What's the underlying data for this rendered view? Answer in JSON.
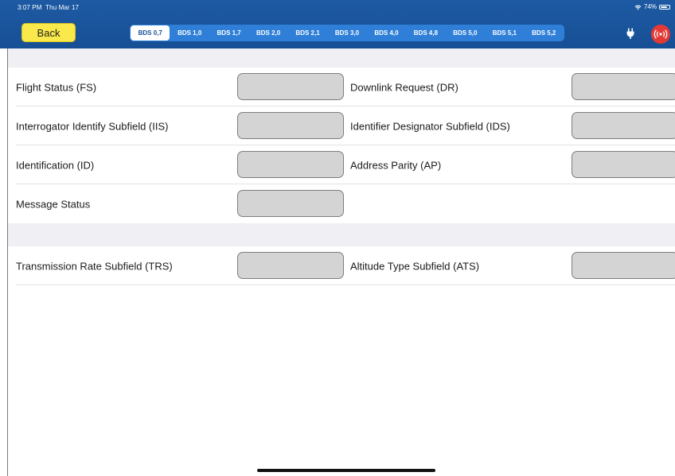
{
  "status_bar": {
    "time": "3:07 PM",
    "date": "Thu Mar 17",
    "battery": "74%"
  },
  "toolbar": {
    "back_label": "Back",
    "tabs": [
      {
        "label": "BDS 0,7",
        "selected": true
      },
      {
        "label": "BDS 1,0",
        "selected": false
      },
      {
        "label": "BDS 1,7",
        "selected": false
      },
      {
        "label": "BDS 2,0",
        "selected": false
      },
      {
        "label": "BDS 2,1",
        "selected": false
      },
      {
        "label": "BDS 3,0",
        "selected": false
      },
      {
        "label": "BDS 4,0",
        "selected": false
      },
      {
        "label": "BDS 4,8",
        "selected": false
      },
      {
        "label": "BDS 5,0",
        "selected": false
      },
      {
        "label": "BDS 5,1",
        "selected": false
      },
      {
        "label": "BDS 5,2",
        "selected": false
      }
    ],
    "icons": [
      "plug-icon",
      "broadcast-icon"
    ]
  },
  "colors": {
    "toolbar_bg": "#1d5aa3",
    "tab_bg": "#2f7fd8",
    "back_button": "#f9e94a",
    "broadcast_button": "#e53935",
    "field_box": "#d4d4d4",
    "section_gap": "#efeff4"
  },
  "section1": {
    "rows": [
      {
        "left_label": "Flight Status (FS)",
        "left_value": "",
        "right_label": "Downlink Request (DR)",
        "right_value": ""
      },
      {
        "left_label": "Interrogator Identify Subfield (IIS)",
        "left_value": "",
        "right_label": "Identifier Designator Subfield (IDS)",
        "right_value": ""
      },
      {
        "left_label": "Identification (ID)",
        "left_value": "",
        "right_label": "Address Parity (AP)",
        "right_value": ""
      },
      {
        "left_label": "Message Status",
        "left_value": ""
      }
    ]
  },
  "section2": {
    "rows": [
      {
        "left_label": "Transmission Rate Subfield (TRS)",
        "left_value": "",
        "right_label": "Altitude Type Subfield (ATS)",
        "right_value": ""
      }
    ]
  }
}
